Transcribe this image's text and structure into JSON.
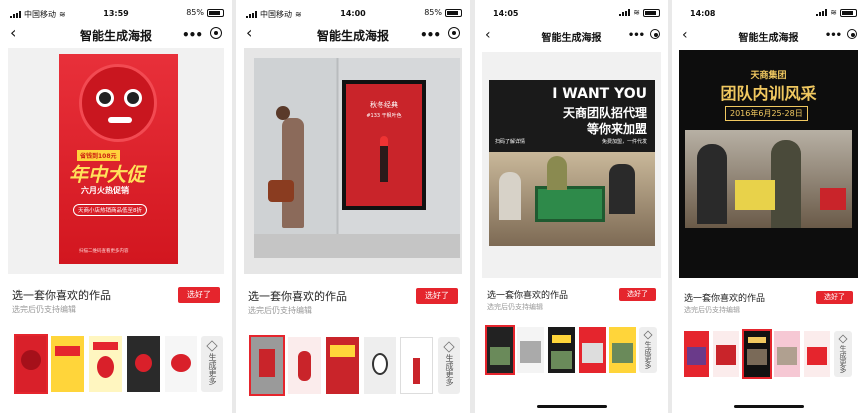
{
  "app": {
    "title": "智能生成海报"
  },
  "screens": [
    {
      "status": {
        "carrier": "中国移动",
        "time": "13:59",
        "battery": "85%"
      },
      "preview": {
        "badge": "省钱到108元",
        "headline": "年中大促",
        "subline": "六月火热促销",
        "tagline": "天商小店热销商品低至8折",
        "footer": "扫描二维码查看更多内容"
      },
      "caption": {
        "title": "选一套你喜欢的作品",
        "subtitle": "选完后仍支持编辑",
        "button": "选好了"
      },
      "more_button": "生成更多"
    },
    {
      "status": {
        "carrier": "中国移动",
        "time": "14:00",
        "battery": "85%"
      },
      "preview": {
        "poster_title": "秋冬经典",
        "poster_sub": "#133 干枫叶色"
      },
      "caption": {
        "title": "选一套你喜欢的作品",
        "subtitle": "选完后仍支持编辑",
        "button": "选好了"
      },
      "more_button": "生成更多"
    },
    {
      "status": {
        "time": "14:05"
      },
      "preview": {
        "line1": "I WANT YOU",
        "line2": "天商团队招代理",
        "line3": "等你来加盟",
        "left_note": "扫码了解详情",
        "right_note": "免费加盟，一件代发"
      },
      "caption": {
        "title": "选一套你喜欢的作品",
        "subtitle": "选完后仍支持编辑",
        "button": "选好了"
      },
      "more_button": "生成更多"
    },
    {
      "status": {
        "time": "14:08"
      },
      "preview": {
        "company": "天商集团",
        "headline": "团队内训风采",
        "date": "2016年6月25-28日"
      },
      "caption": {
        "title": "选一套你喜欢的作品",
        "subtitle": "选完后仍支持编辑",
        "button": "选好了"
      },
      "more_button": "生成更多"
    }
  ],
  "colors": {
    "accent": "#e5252d",
    "poster_red": "#d9202a",
    "dark_poster": "#1a1a1a"
  },
  "icons": [
    "back-icon",
    "more-dots-icon",
    "target-icon",
    "layers-icon",
    "wifi-icon",
    "battery-icon",
    "signal-icon"
  ]
}
